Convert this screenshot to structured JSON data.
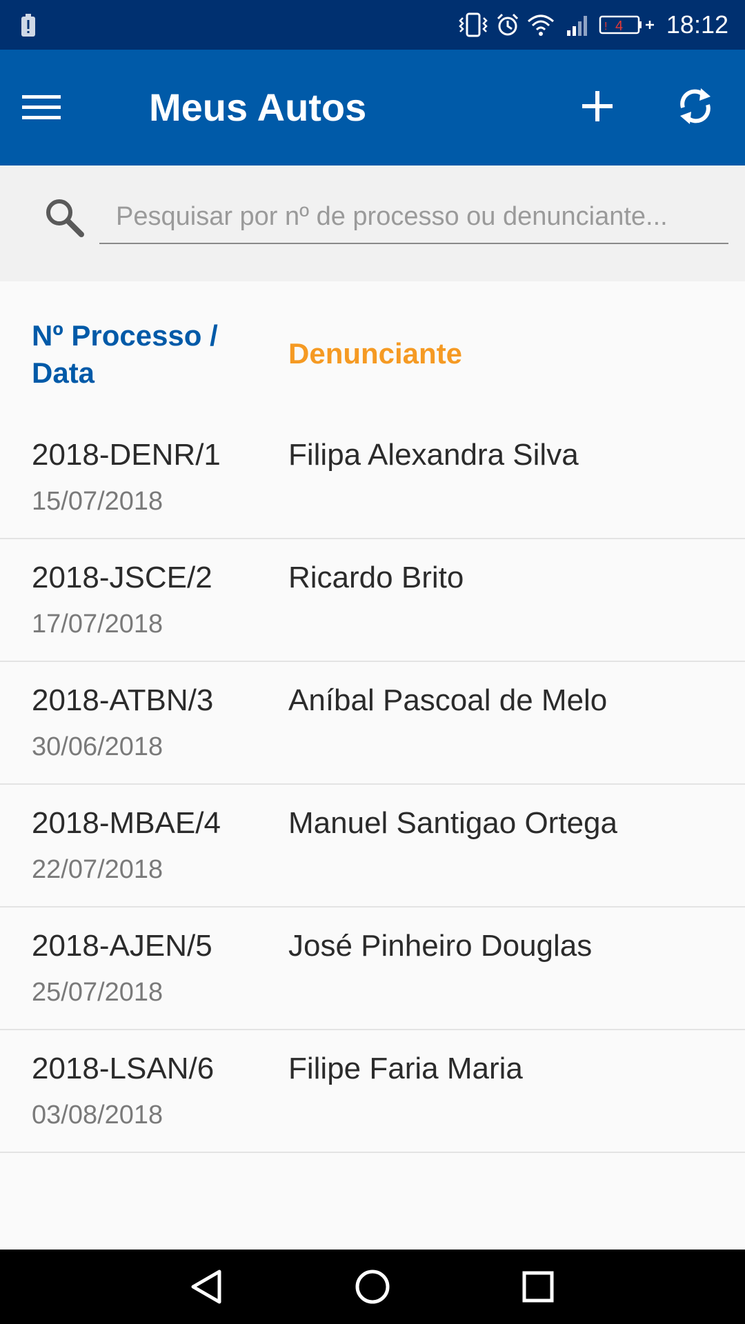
{
  "status_bar": {
    "time": "18:12",
    "battery_level": "4",
    "icons": [
      "alert-icon",
      "vibrate-icon",
      "alarm-icon",
      "wifi-icon",
      "signal-icon",
      "battery-icon"
    ]
  },
  "app_bar": {
    "title": "Meus Autos",
    "icons": [
      "menu-icon",
      "add-icon",
      "refresh-icon"
    ]
  },
  "search": {
    "placeholder": "Pesquisar por nº de processo ou denunciante...",
    "value": ""
  },
  "table": {
    "header_processo": "Nº Processo / Data",
    "header_denunciante": "Denunciante",
    "rows": [
      {
        "processo": "2018-DENR/1",
        "data": "15/07/2018",
        "denunciante": "Filipa Alexandra Silva"
      },
      {
        "processo": "2018-JSCE/2",
        "data": "17/07/2018",
        "denunciante": "Ricardo Brito"
      },
      {
        "processo": "2018-ATBN/3",
        "data": "30/06/2018",
        "denunciante": "Aníbal Pascoal de Melo"
      },
      {
        "processo": "2018-MBAE/4",
        "data": "22/07/2018",
        "denunciante": "Manuel Santigao Ortega"
      },
      {
        "processo": "2018-AJEN/5",
        "data": "25/07/2018",
        "denunciante": "José Pinheiro Douglas"
      },
      {
        "processo": "2018-LSAN/6",
        "data": "03/08/2018",
        "denunciante": "Filipe Faria Maria"
      }
    ]
  },
  "colors": {
    "status_bar": "#003070",
    "primary": "#005aa8",
    "accent": "#f59a23",
    "battery_warning": "#e53935"
  },
  "nav_bar": {
    "icons": [
      "back-icon",
      "home-icon",
      "recents-icon"
    ]
  }
}
